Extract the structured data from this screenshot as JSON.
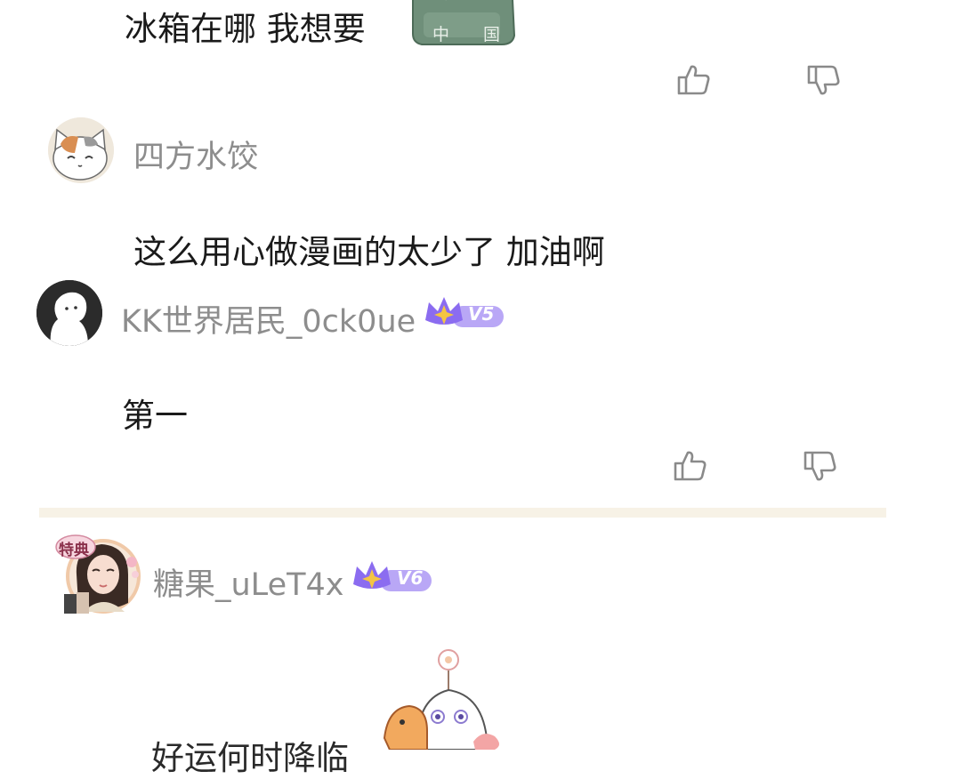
{
  "comments": [
    {
      "text": "冰箱在哪 我想要",
      "sticker_text": "中 国"
    },
    {
      "username": "四方水饺",
      "text": "这么用心做漫画的太少了 加油啊"
    },
    {
      "username": "KK世界居民_0ck0ue",
      "vip": "V5",
      "text": "第一"
    },
    {
      "username": "糖果_uLeT4x",
      "vip": "V6",
      "avatar_badge": "特典",
      "text": "好运何时降临"
    }
  ],
  "icons": {
    "like": "thumbs-up-icon",
    "dislike": "thumbs-down-icon"
  },
  "colors": {
    "username": "#8d8d8d",
    "comment": "#1a1a1a",
    "icon": "#8a8a8a",
    "divider": "#f7f2e6",
    "vip_purple": "#8b6cf0",
    "vip_gold": "#f5c542"
  }
}
